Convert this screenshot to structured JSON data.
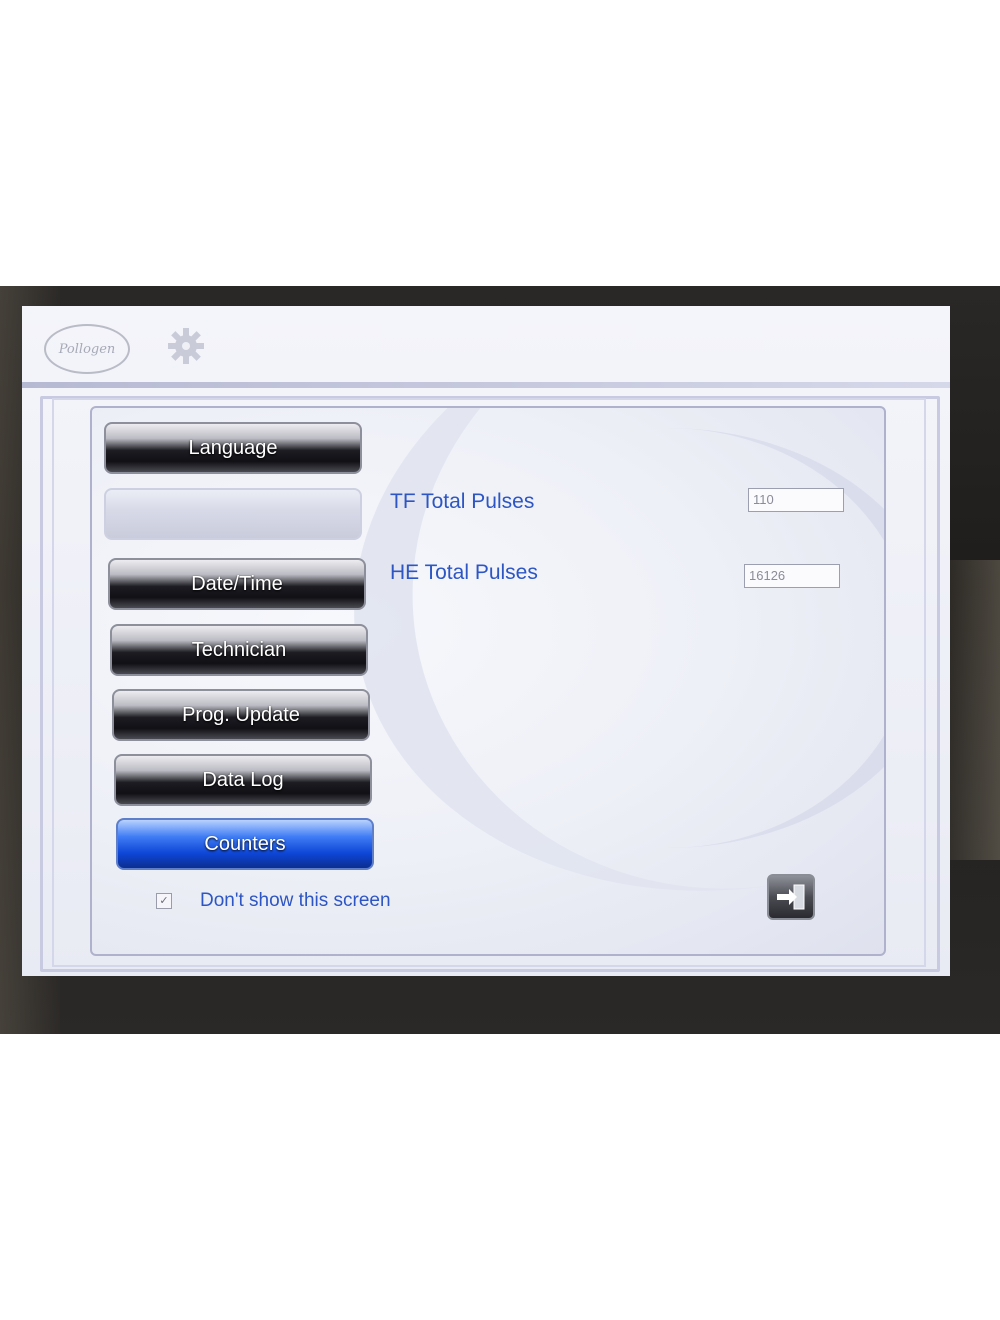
{
  "header": {
    "logo_text": "Pollogen",
    "settings_icon": "gear-icon"
  },
  "menu": {
    "items": [
      {
        "label": "Language",
        "state": "normal"
      },
      {
        "label": "",
        "state": "empty"
      },
      {
        "label": "Date/Time",
        "state": "normal"
      },
      {
        "label": "Technician",
        "state": "normal"
      },
      {
        "label": "Prog. Update",
        "state": "normal"
      },
      {
        "label": "Data Log",
        "state": "normal"
      },
      {
        "label": "Counters",
        "state": "selected"
      }
    ]
  },
  "counters": {
    "tf_label": "TF Total Pulses",
    "tf_value": "110",
    "he_label": "HE Total Pulses",
    "he_value": "16126"
  },
  "footer": {
    "dont_show_label": "Don't show this screen",
    "dont_show_checked": true,
    "checkbox_mark": "✓",
    "exit_icon": "exit-icon"
  },
  "colors": {
    "accent_text": "#2d56c4",
    "selected_button": "#0d45d6"
  }
}
